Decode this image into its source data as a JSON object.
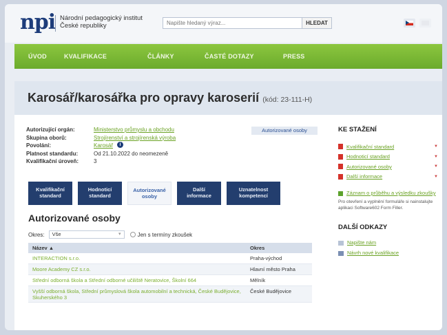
{
  "header": {
    "logo": "npi",
    "institute_line1": "Národní pedagogický institut",
    "institute_line2": "České republiky",
    "search_placeholder": "Napište hledaný výraz...",
    "search_button": "HLEDAT",
    "lang_cz": "cz-flag-icon",
    "lang_en": "en-flag-icon"
  },
  "nav": [
    "ÚVOD",
    "KVALIFIKACE",
    "ČLÁNKY",
    "ČASTÉ DOTAZY",
    "PRESS"
  ],
  "page": {
    "title": "Karosář/karosářka pro opravy karoserií",
    "code": "(kód: 23-111-H)"
  },
  "info": {
    "rows": [
      {
        "label": "Autorizující orgán:",
        "value": "Ministerstvo průmyslu a obchodu",
        "link": true
      },
      {
        "label": "Skupina oborů:",
        "value": "Strojírenství a strojírenská výroba",
        "link": true
      },
      {
        "label": "Povolání:",
        "value": "Karosář",
        "link": true
      },
      {
        "label": "Platnost standardu:",
        "value": "Od 21.10.2022 do neomezeně",
        "link": false
      },
      {
        "label": "Kvalifikační úroveň:",
        "value": "3",
        "link": false
      }
    ],
    "pill": "Autorizované osoby"
  },
  "tabs": [
    {
      "line1": "Kvalifikační",
      "line2": "standard"
    },
    {
      "line1": "Hodnoticí",
      "line2": "standard"
    },
    {
      "line1": "Autorizované",
      "line2": "osoby"
    },
    {
      "line1": "Další",
      "line2": "informace"
    },
    {
      "line1": "Uznatelnost",
      "line2": "kompetencí"
    }
  ],
  "section": {
    "title": "Autorizované osoby",
    "filter_label": "Okres:",
    "filter_value": "Vše",
    "checkbox_label": "Jen s termíny zkoušek"
  },
  "table": {
    "headers": [
      "Název ▲",
      "Okres"
    ],
    "rows": [
      {
        "name": "INTERACTION s.r.o.",
        "okres": "Praha-východ"
      },
      {
        "name": "Moore Academy CZ s.r.o.",
        "okres": "Hlavní město Praha"
      },
      {
        "name": "Střední odborná škola a Střední odborné učiliště Neratovice, Školní 664",
        "okres": "Mělník"
      },
      {
        "name": "Vyšší odborná škola, Střední průmyslová škola automobilní a technická, České Budějovice, Skuherského 3",
        "okres": "České Budějovice"
      }
    ]
  },
  "sidebar": {
    "download_title": "KE STAŽENÍ",
    "downloads": [
      "Kvalifikační standard",
      "Hodnoticí standard",
      "Autorizované osoby",
      "Další informace"
    ],
    "record_link": "Záznam o průběhu a výsledku zkoušky",
    "note": "Pro otevření a vyplnění formuláře si nainstalujte aplikaci Software602 Form Filler.",
    "links_title": "DALŠÍ ODKAZY",
    "links": [
      "Napište nám",
      "Návrh nové kvalifikace"
    ]
  },
  "colors": {
    "nav_green": "#7bb834",
    "tab_navy": "#233e6e",
    "link_green": "#6aa223",
    "logo_blue": "#1d3c7a"
  }
}
